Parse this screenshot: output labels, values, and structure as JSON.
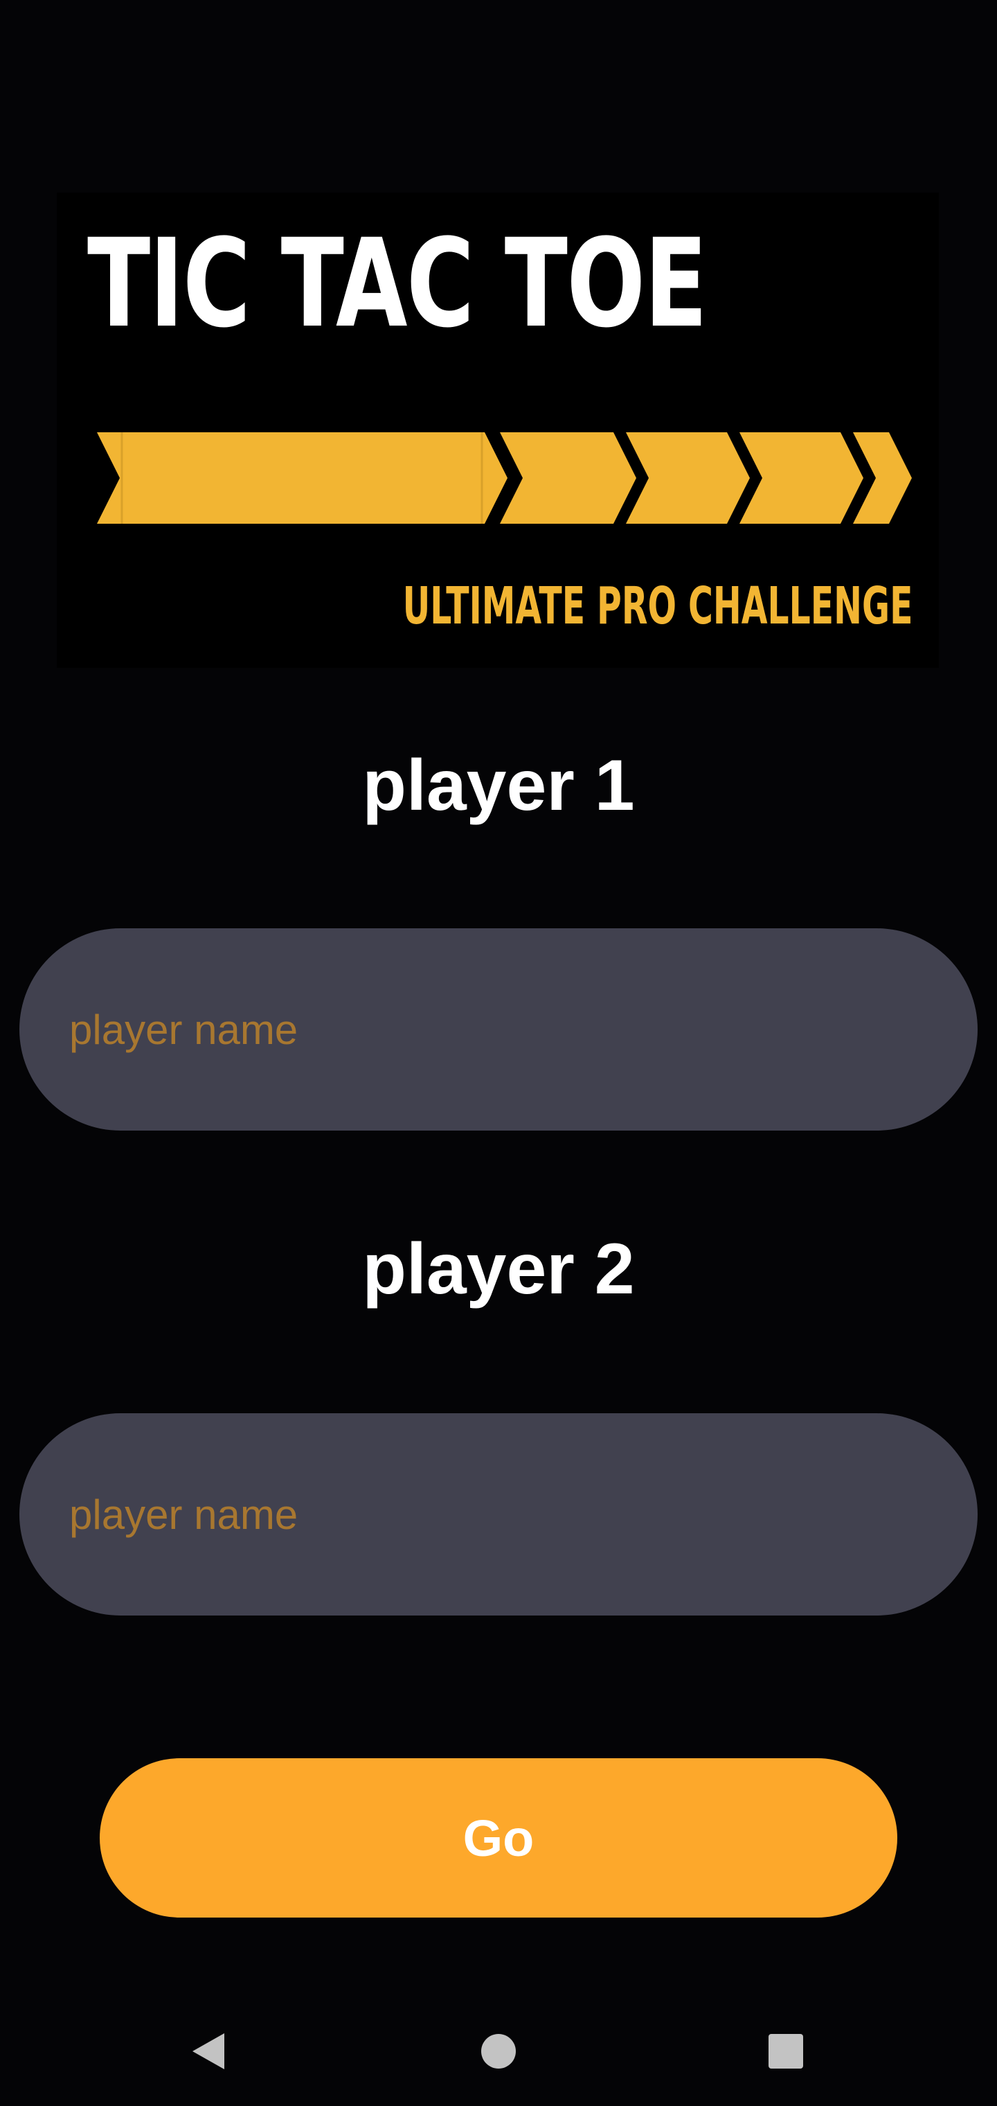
{
  "logo": {
    "title": "TIC TAC TOE",
    "subtitle": "ULTIMATE PRO CHALLENGE",
    "accent_color": "#F2B533"
  },
  "players": [
    {
      "label": "player 1",
      "placeholder": "player name",
      "value": ""
    },
    {
      "label": "player 2",
      "placeholder": "player name",
      "value": ""
    }
  ],
  "go_button": {
    "label": "Go",
    "color": "#FDA82B"
  },
  "field_color": "#41414F",
  "placeholder_color": "#A87730",
  "navbar": {
    "back_icon": "back-triangle-icon",
    "home_icon": "home-circle-icon",
    "recents_icon": "recents-square-icon"
  }
}
